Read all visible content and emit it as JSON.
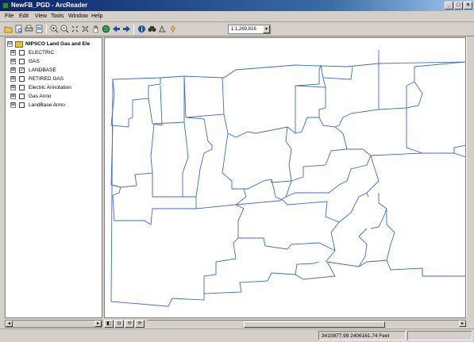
{
  "window": {
    "title": "NewFB_PGD - ArcReader",
    "buttons": {
      "minimize": "_",
      "maximize": "□",
      "close": "×"
    }
  },
  "menu": [
    "File",
    "Edit",
    "View",
    "Tools",
    "Window",
    "Help"
  ],
  "toolbar": {
    "icons": [
      "open-icon",
      "print-preview-icon",
      "print-icon",
      "page-layout-icon",
      "zoom-in-icon",
      "zoom-out-icon",
      "fixed-zoom-in-icon",
      "fixed-zoom-out-icon",
      "pan-icon",
      "full-extent-icon",
      "back-icon",
      "forward-icon",
      "identify-icon",
      "find-icon",
      "measure-icon",
      "hyperlink-icon"
    ],
    "scale": "1:1,269,816",
    "scale_dropdown": "▾"
  },
  "toc": {
    "root": {
      "label": "NIPSCO Land Gas and Ele",
      "expander": "⊟"
    },
    "layers": [
      {
        "label": "ELECTRIC",
        "checked": "",
        "expander": "⊞"
      },
      {
        "label": "GAS",
        "checked": "",
        "expander": "⊞"
      },
      {
        "label": "LANDBASE",
        "checked": "✓",
        "expander": "⊞"
      },
      {
        "label": "RETIRED GAS",
        "checked": "",
        "expander": "⊞"
      },
      {
        "label": "Electric Annotation",
        "checked": "",
        "expander": "⊞"
      },
      {
        "label": "Gas Anno",
        "checked": "",
        "expander": "⊞"
      },
      {
        "label": "LandBase Anno",
        "checked": "",
        "expander": "⊞"
      }
    ]
  },
  "map": {
    "boundary_color": "#3c6dc0",
    "background": "#ffffff"
  },
  "view_buttons": [
    "◧",
    "◘",
    "⟲",
    "⟳"
  ],
  "status": {
    "coordinates": "3410877.99  2406161.74 Feet"
  }
}
